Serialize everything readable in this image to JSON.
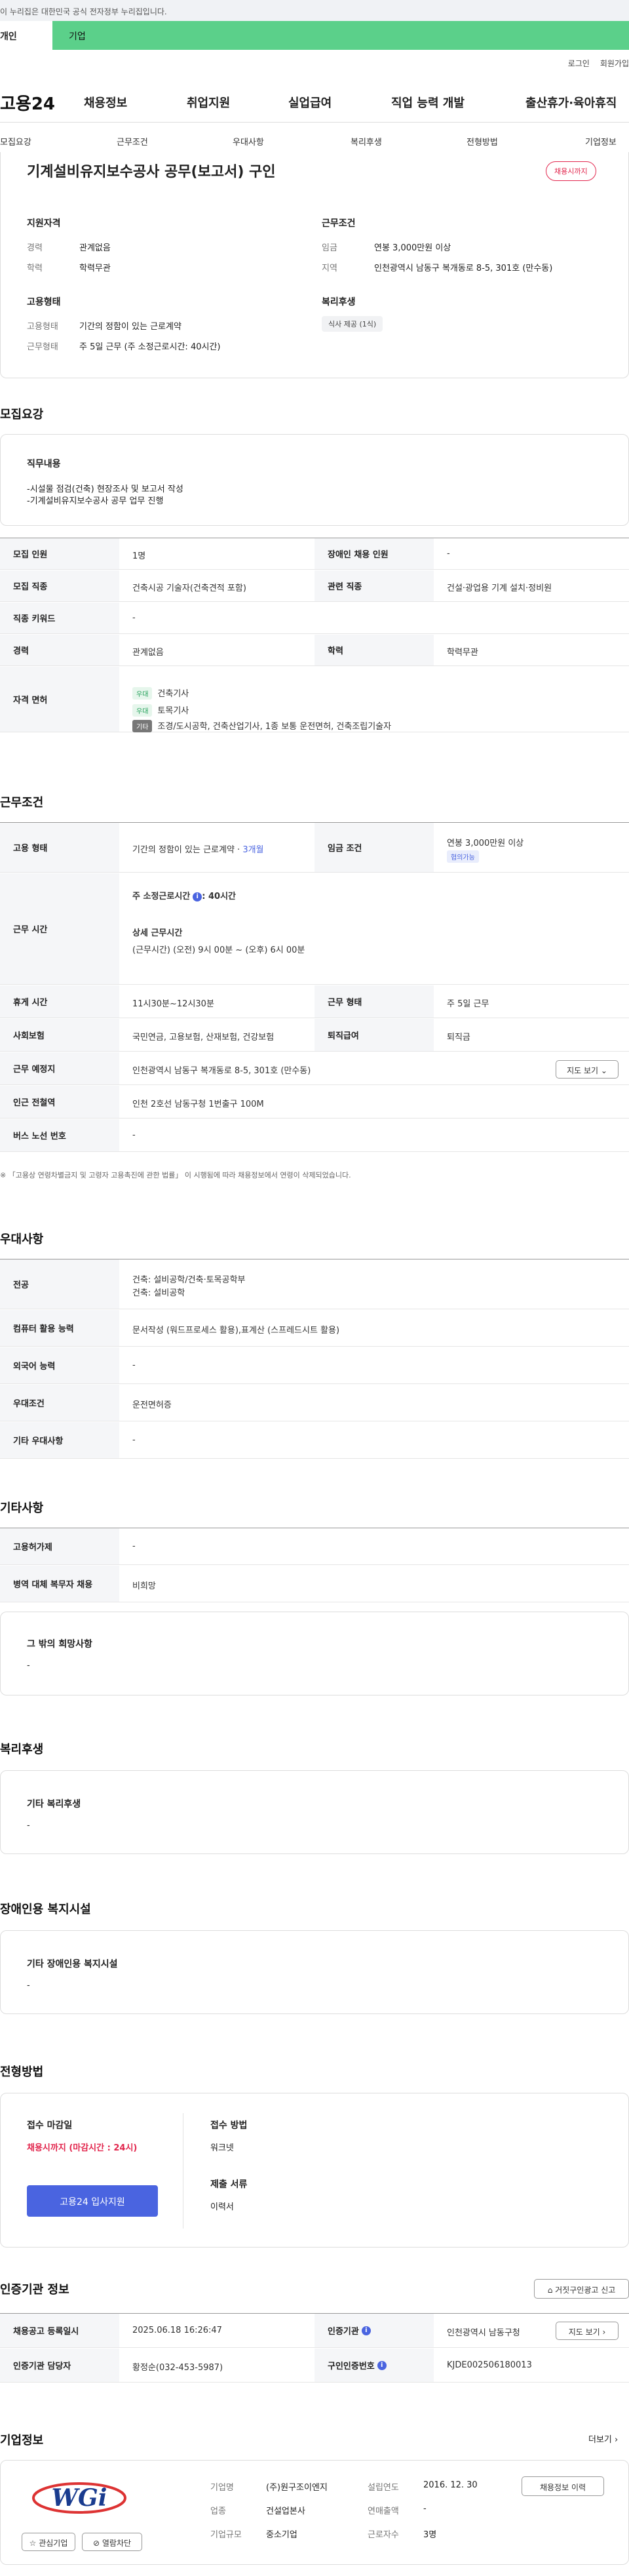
{
  "gov_bar": {
    "text": "이 누리집은 대한민국 공식 전자정부 누리집입니다."
  },
  "user_tabs": {
    "personal": "개인",
    "company": "기업"
  },
  "util": {
    "login": "로그인",
    "join": "회원가입"
  },
  "logo": "고용24",
  "gnb": [
    "채용정보",
    "취업지원",
    "실업급여",
    "직업 능력 개발",
    "출산휴가·육아휴직"
  ],
  "subnav": [
    "모집요강",
    "근무조건",
    "우대사항",
    "복리후생",
    "전형방법",
    "기업정보"
  ],
  "job": {
    "title": "기계설비유지보수공사 공무(보고서) 구인",
    "deadline_badge": "채용시까지",
    "qualification": {
      "heading": "지원자격",
      "career_label": "경력",
      "career": "관계없음",
      "edu_label": "학력",
      "edu": "학력무관"
    },
    "conditions": {
      "heading": "근무조건",
      "wage_label": "임금",
      "wage": "연봉 3,000만원 이상",
      "region_label": "지역",
      "region": "인천광역시 남동구 복개동로 8-5, 301호 (만수동)"
    },
    "employment": {
      "heading": "고용형태",
      "type_label": "고용형태",
      "type": "기간의 정함이 있는 근로계약",
      "hours_label": "근무형태",
      "hours": "주 5일 근무 (주 소정근로시간: 40시간)"
    },
    "welfare": {
      "heading": "복리후생",
      "item": "식사 제공 (1식)"
    }
  },
  "recruit": {
    "title": "모집요강",
    "duty_heading": "직무내용",
    "duty_lines": [
      "-시설물 점검(건축) 현장조사 및 보고서 작성",
      "-기계설비유지보수공사 공무 업무 진행"
    ],
    "rows": {
      "count_label": "모집 인원",
      "count": "1명",
      "disabled_label": "장애인 채용 인원",
      "disabled": "-",
      "job_label": "모집 직종",
      "job": "건축시공 기술자(건축견적 포함)",
      "related_label": "관련 직종",
      "related": "건설·광업용 기계 설치·정비원",
      "keyword_label": "직종 키워드",
      "keyword": "-",
      "career_label": "경력",
      "career": "관계없음",
      "edu_label": "학력",
      "edu": "학력무관",
      "license_label": "자격 면허",
      "licenses": [
        {
          "tag": "우대",
          "name": "건축기사"
        },
        {
          "tag": "우대",
          "name": "토목기사"
        },
        {
          "tag": "기타",
          "name": "조경/도시공학, 건축산업기사, 1종 보통 운전면허, 건축조립기술자"
        }
      ]
    }
  },
  "work": {
    "title": "근무조건",
    "type_label": "고용 형태",
    "type": "기간의 정함이 있는 근로계약 ·",
    "type_period": "3개월",
    "wage_label": "임금 조건",
    "wage": "연봉 3,000만원 이상",
    "wage_tag": "협의가능",
    "time_label": "근무 시간",
    "time_week": "주 소정근로시간",
    "time_week_val": ": 40시간",
    "time_detail_heading": "상세 근무시간",
    "time_detail": "(근무시간) (오전) 9시 00분 ~ (오후) 6시 00분",
    "rest_label": "휴게 시간",
    "rest": "11시30분~12시30분",
    "form_label": "근무 형태",
    "form": "주 5일 근무",
    "insurance_label": "사회보험",
    "insurance": "국민연금, 고용보험, 산재보험, 건강보험",
    "retire_label": "퇴직급여",
    "retire": "퇴직금",
    "place_label": "근무 예정지",
    "place": "인천광역시 남동구 복개동로 8-5, 301호 (만수동)",
    "map_btn": "지도 보기",
    "station_label": "인근 전철역",
    "station": "인천 2호선 남동구청 1번출구 100M",
    "bus_label": "버스 노선 번호",
    "bus": "-",
    "footnote": "※ 「고용상 연령차별금지 및 고령자 고용촉진에 관한 법률」 이 시행됨에 따라 채용정보에서 연령이 삭제되었습니다."
  },
  "prefer": {
    "title": "우대사항",
    "major_label": "전공",
    "major_lines": [
      "건축: 설비공학/건축·토목공학부",
      "건축: 설비공학"
    ],
    "computer_label": "컴퓨터 활용 능력",
    "computer": "문서작성 (워드프로세스 활용),표계산 (스프레드시트 활용)",
    "lang_label": "외국어 능력",
    "lang": "-",
    "cond_label": "우대조건",
    "cond": "운전면허증",
    "etc_label": "기타 우대사항",
    "etc": "-"
  },
  "other": {
    "title": "기타사항",
    "style_label": "고용허가제",
    "style": "-",
    "military_label": "병역 대체 복무자 채용",
    "military": "비희망",
    "wish_heading": "그 밖의 희망사항",
    "wish": "-"
  },
  "benefit": {
    "title": "복리후생",
    "heading": "기타 복리후생",
    "value": "-"
  },
  "facility": {
    "title": "장애인용 복지시설",
    "heading": "기타 장애인용 복지시설",
    "value": "-"
  },
  "selection": {
    "title": "전형방법",
    "deadline_heading": "접수 마감일",
    "deadline": "채용시까지 (마감시간 : 24시)",
    "apply_btn": "고용24 입사지원",
    "method_heading": "접수 방법",
    "method": "워크넷",
    "docs_heading": "제출 서류",
    "docs": "이력서"
  },
  "agency": {
    "title": "인증기관 정보",
    "report_btn": "거짓구인광고 신고",
    "reg_label": "채용공고 등록일시",
    "reg": "2025.06.18 16:26:47",
    "org_label": "인증기관",
    "org": "인천광역시 남동구청",
    "map_btn": "지도 보기",
    "manager_label": "인증기관 담당자",
    "manager": "황정순(032-453-5987)",
    "number_label": "구인인증번호",
    "number": "KJDE002506180013"
  },
  "company": {
    "title": "기업정보",
    "more": "더보기",
    "name_label": "기업명",
    "name": "(주)원구조이엔지",
    "founded_label": "설립연도",
    "founded": "2016. 12. 30",
    "industry_label": "업종",
    "industry": "건설업본사",
    "revenue_label": "연매출액",
    "revenue": "-",
    "scale_label": "기업규모",
    "scale": "중소기업",
    "staff_label": "근로자수",
    "staff": "3명",
    "info_btn": "채용정보 이력",
    "fav_btn": "관심기업",
    "block_btn": "열람차단",
    "logo_text": "WGi"
  },
  "colors": {
    "accent_green": "#5bd08a",
    "accent_red": "#e2264d",
    "accent_blue": "#4a64e0"
  }
}
